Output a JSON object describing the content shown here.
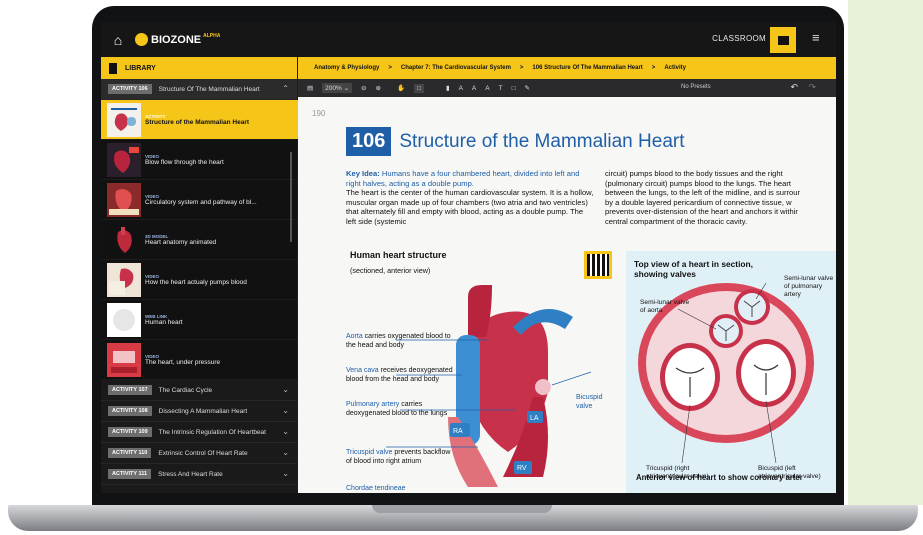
{
  "app": {
    "logo_text": "BIOZONE",
    "logo_tag": "ALPHA",
    "classroom_label": "CLASSROOM"
  },
  "sidebar": {
    "header": "LIBRARY",
    "current_activity": {
      "badge": "ACTIVITY 106",
      "title": "Structure Of The Mammalian Heart"
    },
    "items": [
      {
        "kind": "ACTIVITY",
        "title": "Structure of the Mammalian Heart",
        "active": true
      },
      {
        "kind": "VIDEO",
        "title": "Blow flow through the heart"
      },
      {
        "kind": "VIDEO",
        "title": "Circulatory system and pathway of bl..."
      },
      {
        "kind": "3D MODEL",
        "title": "Heart anatomy animated"
      },
      {
        "kind": "VIDEO",
        "title": "How the heart actualy pumps blood"
      },
      {
        "kind": "WEB LINK",
        "title": "Human heart"
      },
      {
        "kind": "VIDEO",
        "title": "The heart, under pressure"
      }
    ],
    "activities": [
      {
        "badge": "ACTIVITY 107",
        "title": "The Cardiac Cycle"
      },
      {
        "badge": "ACTIVITY 108",
        "title": "Dissecting A Mammalian Heart"
      },
      {
        "badge": "ACTIVITY 109",
        "title": "The Intrinsic Regulation Of Heartbeat"
      },
      {
        "badge": "ACTIVITY 110",
        "title": "Extrinsic Control Of Heart Rate"
      },
      {
        "badge": "ACTIVITY 111",
        "title": "Stress And Heart Rate"
      }
    ]
  },
  "breadcrumb": [
    "Anatomy & Physiology",
    "Chapter 7: The Cardiovascular System",
    "106 Structure Of The Mammalian Heart",
    "Activity"
  ],
  "breadcrumb_sep": ">",
  "toolbar": {
    "zoom": "200%",
    "presets": "No Presets"
  },
  "page": {
    "page_number": "190",
    "activity_number": "106",
    "title": "Structure of the Mammalian Heart",
    "key_idea_label": "Key Idea:",
    "key_idea_text": " Humans have a four chambered heart, divided into left and right halves, acting as a double pump.",
    "body_col1": "The heart is the center of the human cardiovascular system. It is a hollow, muscular organ made up of four chambers (two atria and two ventricles) that alternately fill and empty with blood, acting as a double pump. The left side (systemic",
    "body_col2": [
      "circuit) pumps blood to the body tissues and the right",
      "(pulmonary circuit) pumps blood to the lungs. The heart",
      "between the lungs, to the left of the midline, and is surrour",
      "by a double layered pericardium of connective tissue, w",
      "prevents over-distension of the heart and anchors it withir",
      "central compartment of the thoracic cavity."
    ],
    "diagram_title": "Human heart structure",
    "diagram_subtitle": "(sectioned, anterior view)",
    "labels": {
      "aorta_term": "Aorta",
      "aorta_text": " carries oxygenated blood to the head and body",
      "vena_cava_term": "Vena cava",
      "vena_cava_text": " receives deoxygenated blood from the head and body",
      "pulmonary_term": "Pulmonary artery",
      "pulmonary_text": " carries deoxygenated blood to the lungs",
      "tricuspid_term": "Tricuspid valve",
      "tricuspid_text": " prevents backflow of blood into right atrium",
      "bicuspid_term": "Bicuspid valve",
      "ra": "RA",
      "la": "LA",
      "rv": "RV",
      "chordae": "Chordae tendineae"
    },
    "top_view": {
      "title": "Top view of a heart in section, showing valves",
      "semilunar_pulmonary": "Semi-lunar valve of pulmonary artery",
      "semilunar_aorta": "Semi-lunar valve of aorta",
      "tricuspid": "Tricuspid (right atrioventricular valve)",
      "bicuspid": "Bicuspid (left atrioventricular valve)",
      "anterior_caption": "Anterior view of heart to show coronary arter"
    }
  }
}
